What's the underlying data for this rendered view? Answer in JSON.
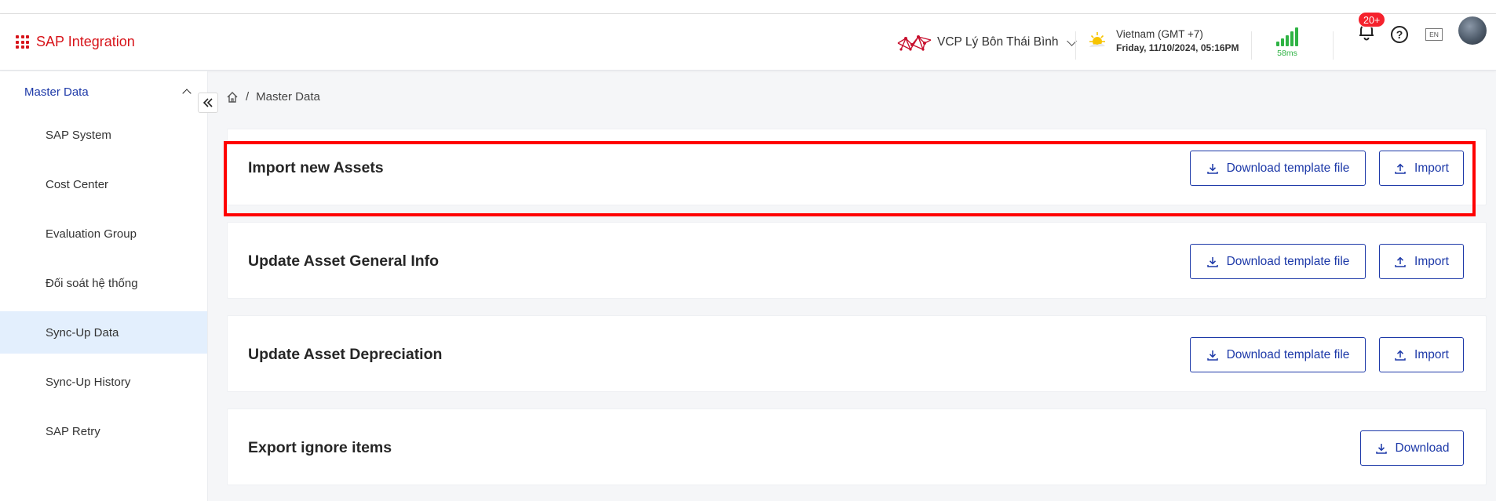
{
  "header": {
    "brand": "SAP Integration",
    "company": "VCP Lý Bôn Thái Bình",
    "timezone": "Vietnam (GMT +7)",
    "datetime": "Friday, 11/10/2024, 05:16PM",
    "latency": "58ms",
    "notif_count": "20+",
    "help_glyph": "?",
    "lang": "EN",
    "colors": {
      "brand": "#d7141a",
      "primary": "#1d39a8",
      "signal": "#2fb344",
      "badge": "#f5222d"
    }
  },
  "sidebar": {
    "group": "Master Data",
    "items": [
      {
        "label": "SAP System",
        "active": false
      },
      {
        "label": "Cost Center",
        "active": false
      },
      {
        "label": "Evaluation Group",
        "active": false
      },
      {
        "label": "Đối soát hệ thống",
        "active": false
      },
      {
        "label": "Sync-Up Data",
        "active": true
      },
      {
        "label": "Sync-Up History",
        "active": false
      },
      {
        "label": "SAP Retry",
        "active": false
      }
    ]
  },
  "breadcrumb": {
    "separator": "/",
    "current": "Master Data"
  },
  "cards": [
    {
      "title": "Import new Assets",
      "download_label": "Download template file",
      "import_label": "Import"
    },
    {
      "title": "Update Asset General Info",
      "download_label": "Download template file",
      "import_label": "Import"
    },
    {
      "title": "Update Asset Depreciation",
      "download_label": "Download template file",
      "import_label": "Import"
    },
    {
      "title": "Export ignore items",
      "download_label": "Download"
    }
  ]
}
